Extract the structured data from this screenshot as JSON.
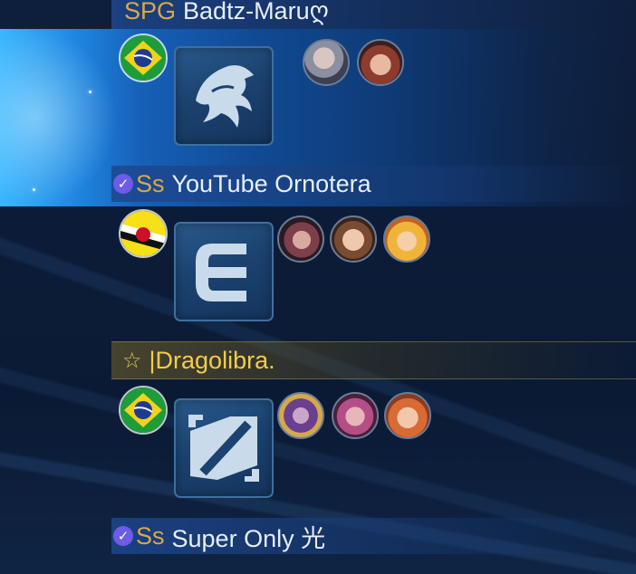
{
  "players": [
    {
      "rank_label": "SPG",
      "name": "Badtz-Maruღ",
      "flag": "brazil-flag-icon",
      "emblem": "mage-claw-emblem-icon",
      "heroes": [
        "hero-portrait-silver-armor",
        "hero-portrait-red-hair"
      ]
    },
    {
      "rank_label": "Ss",
      "name": "YouTube Ornotera",
      "verified": true,
      "flag": "brunei-flag-icon",
      "emblem": "fighter-emblem-icon",
      "heroes": [
        "hero-portrait-dark-hair",
        "hero-portrait-brown-hair",
        "hero-portrait-blonde-kid"
      ]
    },
    {
      "star": "☆",
      "name": "|Dragolibra.",
      "flag": "brazil-flag-icon",
      "emblem": "marksman-emblem-icon",
      "heroes": [
        "hero-portrait-purple-armor",
        "hero-portrait-pink-hair",
        "hero-portrait-orange-kid"
      ]
    },
    {
      "rank_label": "Ss",
      "name": "Super Only 光",
      "verified": true
    }
  ],
  "colors": {
    "rank_gold": "#d8a948",
    "highlight_name": "#f3cc4b",
    "verified_badge": "#6c5ce7",
    "selected_row": "#1f86e0"
  }
}
